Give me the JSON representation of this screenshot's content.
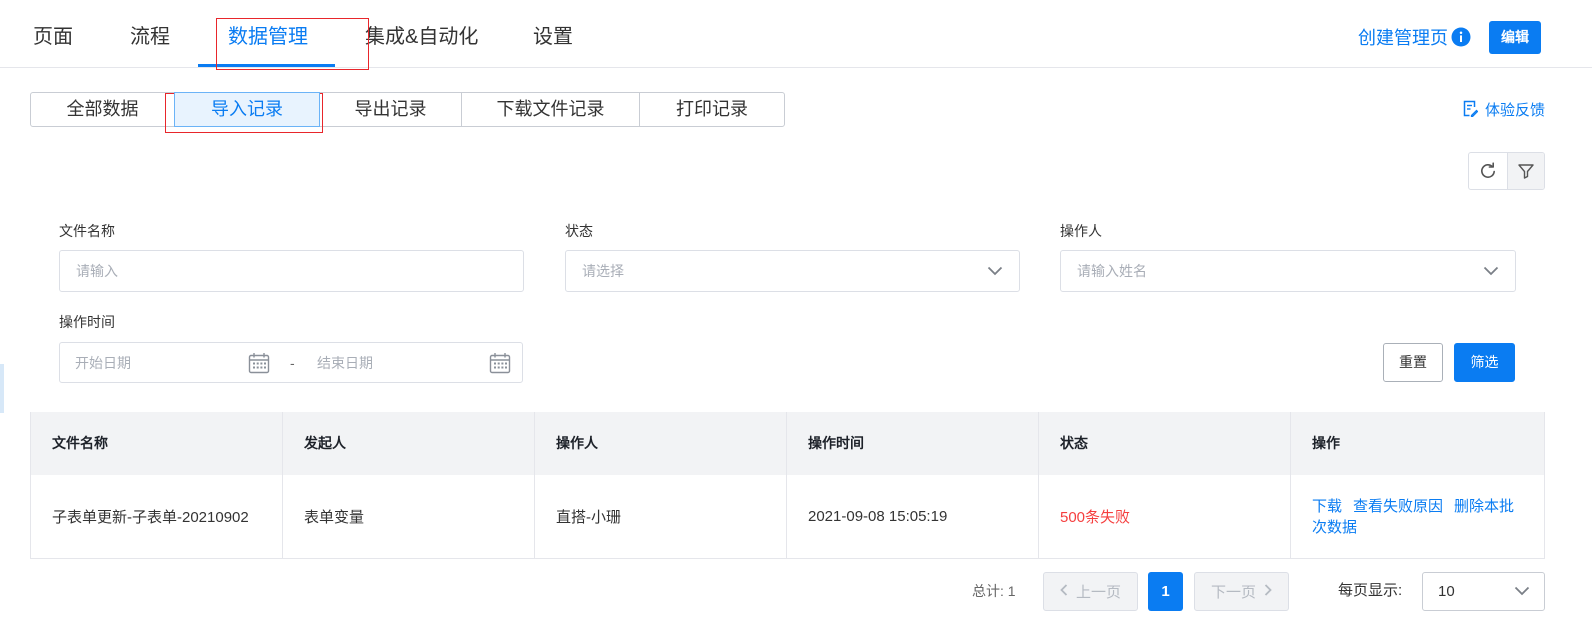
{
  "nav": {
    "tabs": [
      {
        "label": "页面",
        "active": false
      },
      {
        "label": "流程",
        "active": false
      },
      {
        "label": "数据管理",
        "active": true
      },
      {
        "label": "集成&自动化",
        "active": false
      },
      {
        "label": "设置",
        "active": false
      }
    ],
    "create_label": "创建管理页",
    "edit_label": "编辑"
  },
  "subtabs": [
    {
      "label": "全部数据",
      "active": false
    },
    {
      "label": "导入记录",
      "active": true
    },
    {
      "label": "导出记录",
      "active": false
    },
    {
      "label": "下载文件记录",
      "active": false
    },
    {
      "label": "打印记录",
      "active": false
    }
  ],
  "feedback_label": "体验反馈",
  "filters": {
    "file_name": {
      "label": "文件名称",
      "placeholder": "请输入"
    },
    "status": {
      "label": "状态",
      "placeholder": "请选择"
    },
    "operator": {
      "label": "操作人",
      "placeholder": "请输入姓名"
    },
    "time": {
      "label": "操作时间",
      "start_placeholder": "开始日期",
      "separator": "-",
      "end_placeholder": "结束日期"
    },
    "reset_label": "重置",
    "submit_label": "筛选"
  },
  "table": {
    "columns": [
      "文件名称",
      "发起人",
      "操作人",
      "操作时间",
      "状态",
      "操作"
    ],
    "rows": [
      {
        "file_name": "子表单更新-子表单-20210902",
        "initiator": "表单变量",
        "operator": "直搭-小珊",
        "time": "2021-09-08 15:05:19",
        "status": "500条失败",
        "actions": [
          {
            "label": "下载"
          },
          {
            "label": "查看失败原因"
          },
          {
            "label": "删除本批次数据"
          }
        ]
      }
    ]
  },
  "pagination": {
    "total_label": "总计:",
    "total": "1",
    "prev_label": "上一页",
    "current_page": "1",
    "next_label": "下一页",
    "page_size_label": "每页显示:",
    "page_size": "10"
  },
  "icons": {
    "info": "info-icon",
    "feedback": "feedback-icon",
    "refresh": "refresh-icon",
    "filter": "filter-icon",
    "calendar": "calendar-icon",
    "dropdown": "chevron-down-icon"
  },
  "colors": {
    "primary": "#0a7cf2",
    "danger": "#f53f3f",
    "highlight": "#e8262b"
  }
}
